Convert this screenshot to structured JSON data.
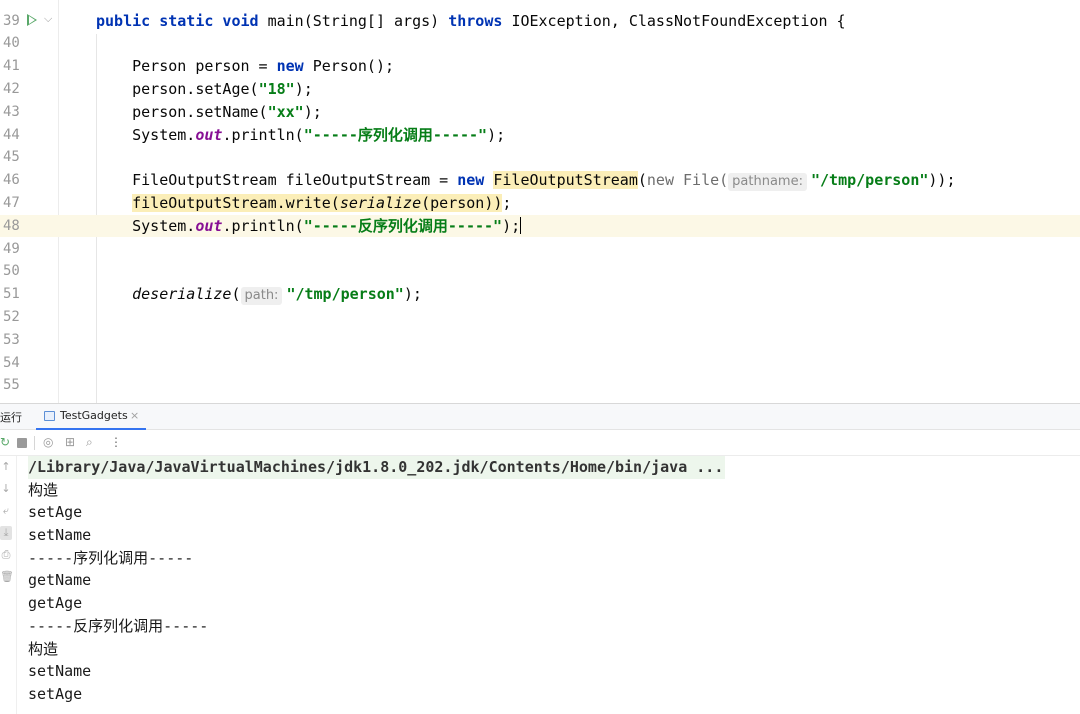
{
  "editor": {
    "lines": [
      {
        "n": "39",
        "tokens": [
          {
            "t": "public static void ",
            "c": "kw"
          },
          {
            "t": "main(String[] args) ",
            "c": ""
          },
          {
            "t": "throws ",
            "c": "kw"
          },
          {
            "t": "IOException, ClassNotFoundException {",
            "c": ""
          }
        ]
      },
      {
        "n": "40",
        "tokens": []
      },
      {
        "n": "41",
        "tokens": [
          {
            "t": "    Person person = ",
            "c": ""
          },
          {
            "t": "new ",
            "c": "kw"
          },
          {
            "t": "Person();",
            "c": ""
          }
        ]
      },
      {
        "n": "42",
        "tokens": [
          {
            "t": "    person.setAge(",
            "c": ""
          },
          {
            "t": "\"18\"",
            "c": "str"
          },
          {
            "t": ");",
            "c": ""
          }
        ]
      },
      {
        "n": "43",
        "tokens": [
          {
            "t": "    person.setName(",
            "c": ""
          },
          {
            "t": "\"xx\"",
            "c": "str"
          },
          {
            "t": ");",
            "c": ""
          }
        ]
      },
      {
        "n": "44",
        "tokens": [
          {
            "t": "    System.",
            "c": ""
          },
          {
            "t": "out",
            "c": "field"
          },
          {
            "t": ".println(",
            "c": ""
          },
          {
            "t": "\"-----序列化调用-----\"",
            "c": "str"
          },
          {
            "t": ");",
            "c": ""
          }
        ]
      },
      {
        "n": "45",
        "tokens": []
      },
      {
        "n": "46",
        "tokens": [
          {
            "t": "    FileOutputStream fileOutputStream = ",
            "c": ""
          },
          {
            "t": "new ",
            "c": "kw"
          },
          {
            "t": "FileOutputStream",
            "c": "hl"
          },
          {
            "t": "(",
            "c": ""
          },
          {
            "t": "new ",
            "c": "muted"
          },
          {
            "t": "File(",
            "c": "muted"
          },
          {
            "t": "pathname:",
            "c": "hint"
          },
          {
            "t": "\"/tmp/person\"",
            "c": "str"
          },
          {
            "t": "));",
            "c": ""
          }
        ]
      },
      {
        "n": "47",
        "tokens": [
          {
            "t": "    ",
            "c": ""
          },
          {
            "t": "fileOutputStream.write(",
            "c": "hl"
          },
          {
            "t": "serialize",
            "c": "hl ital"
          },
          {
            "t": "(person))",
            "c": "hl"
          },
          {
            "t": ";",
            "c": ""
          }
        ]
      },
      {
        "n": "48",
        "current": true,
        "tokens": [
          {
            "t": "    System.",
            "c": ""
          },
          {
            "t": "out",
            "c": "field"
          },
          {
            "t": ".println(",
            "c": ""
          },
          {
            "t": "\"-----反序列化调用-----\"",
            "c": "str"
          },
          {
            "t": ");",
            "c": ""
          },
          {
            "t": "",
            "c": "caret"
          }
        ]
      },
      {
        "n": "49",
        "tokens": []
      },
      {
        "n": "50",
        "tokens": []
      },
      {
        "n": "51",
        "tokens": [
          {
            "t": "    ",
            "c": ""
          },
          {
            "t": "deserialize",
            "c": "ital"
          },
          {
            "t": "(",
            "c": ""
          },
          {
            "t": "path:",
            "c": "hint"
          },
          {
            "t": "\"/tmp/person\"",
            "c": "str"
          },
          {
            "t": ");",
            "c": ""
          }
        ]
      },
      {
        "n": "52",
        "tokens": []
      },
      {
        "n": "53",
        "tokens": []
      },
      {
        "n": "54",
        "tokens": []
      },
      {
        "n": "55",
        "tokens": []
      }
    ]
  },
  "run_panel": {
    "label": "运行",
    "tab": {
      "label": "TestGadgets",
      "close": "×"
    },
    "toolbar_more": "⋮",
    "console": {
      "command": "/Library/Java/JavaVirtualMachines/jdk1.8.0_202.jdk/Contents/Home/bin/java ...",
      "output": [
        "构造",
        "setAge",
        "setName",
        "-----序列化调用-----",
        "getName",
        "getAge",
        "-----反序列化调用-----",
        "构造",
        "setName",
        "setAge"
      ]
    }
  },
  "colors": {
    "keyword": "#0033b3",
    "string": "#067d17",
    "static_field": "#871094",
    "current_line": "#fcf8e6",
    "highlight": "#fbeeb8",
    "tab_underline": "#3574f0"
  }
}
